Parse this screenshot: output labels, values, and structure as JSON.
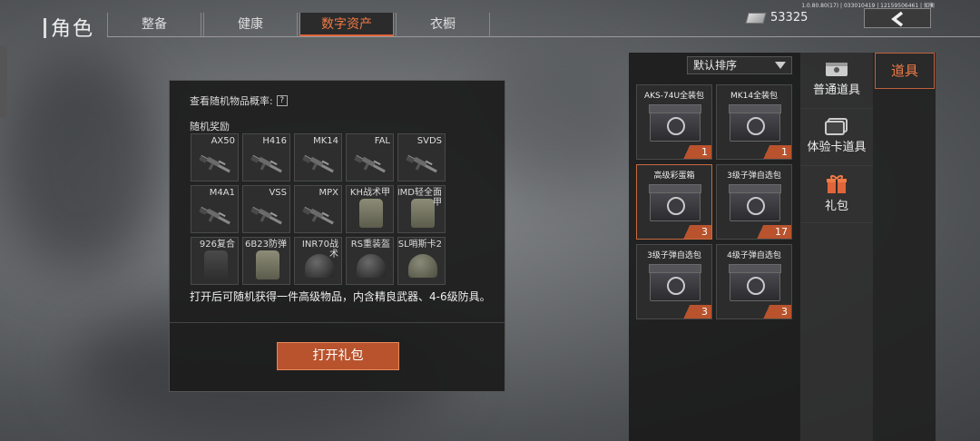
{
  "header": {
    "title": "角色",
    "tabs": [
      {
        "label": "整备"
      },
      {
        "label": "健康"
      },
      {
        "label": "数字资产",
        "active": true
      },
      {
        "label": "衣橱"
      }
    ],
    "version": "1.0.80.80(17) | 033010419 | 12159506461 | 如衡",
    "currency": "53325",
    "back_icon": "chevron-left-icon"
  },
  "dialog": {
    "prob_label": "查看随机物品概率:",
    "prob_help": "?",
    "reward_label": "随机奖励",
    "rewards": [
      {
        "name": "AX50",
        "icon": "rifle"
      },
      {
        "name": "H416",
        "icon": "rifle"
      },
      {
        "name": "MK14",
        "icon": "rifle"
      },
      {
        "name": "FAL",
        "icon": "rifle"
      },
      {
        "name": "SVDS",
        "icon": "rifle"
      },
      {
        "name": "M4A1",
        "icon": "rifle"
      },
      {
        "name": "VSS",
        "icon": "rifle"
      },
      {
        "name": "MPX",
        "icon": "smg"
      },
      {
        "name": "KH战术甲",
        "icon": "vest"
      },
      {
        "name": "IMD轻全面甲",
        "icon": "vest"
      },
      {
        "name": "926复合",
        "icon": "vest"
      },
      {
        "name": "6B23防弹",
        "icon": "vest"
      },
      {
        "name": "INR70战术",
        "icon": "helmet"
      },
      {
        "name": "RS重装盔",
        "icon": "helmet"
      },
      {
        "name": "SL哨斯卡2",
        "icon": "helmet"
      }
    ],
    "description": "打开后可随机获得一件高级物品，内含精良武器、4-6级防具。",
    "open_button": "打开礼包"
  },
  "inventory": {
    "sort_label": "默认排序",
    "items": [
      {
        "name": "AKS-74U全装包",
        "qty": "1"
      },
      {
        "name": "MK14全装包",
        "qty": "1"
      },
      {
        "name": "高级彩蛋箱",
        "qty": "3",
        "selected": true
      },
      {
        "name": "3级子弹自选包",
        "qty": "17"
      },
      {
        "name": "3级子弹自选包",
        "qty": "3"
      },
      {
        "name": "4级子弹自选包",
        "qty": "3"
      }
    ]
  },
  "categories": [
    {
      "label": "普通道具",
      "icon": "crate-icon"
    },
    {
      "label": "体验卡道具",
      "icon": "card-icon"
    },
    {
      "label": "礼包",
      "icon": "gift-icon"
    }
  ],
  "side_tab": "道具",
  "colors": {
    "accent": "#e0653a",
    "panel": "#1c1c1c"
  }
}
